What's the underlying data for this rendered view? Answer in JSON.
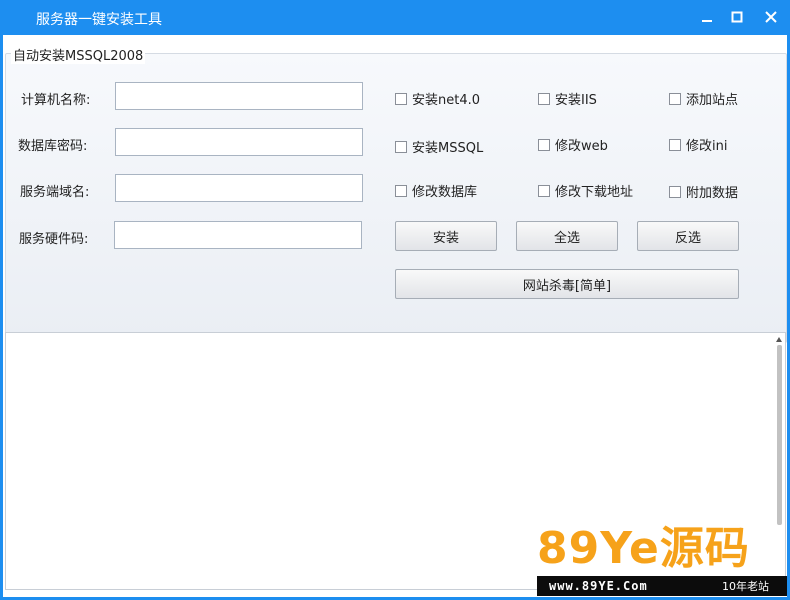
{
  "window": {
    "title": "服务器一键安装工具"
  },
  "group": {
    "legend": "自动安装MSSQL2008"
  },
  "fields": [
    {
      "label": "计算机名称:",
      "value": ""
    },
    {
      "label": "数据库密码:",
      "value": ""
    },
    {
      "label": "服务端域名:",
      "value": ""
    },
    {
      "label": "服务硬件码:",
      "value": ""
    }
  ],
  "checkboxes": [
    {
      "label": "安装net4.0",
      "checked": false
    },
    {
      "label": "安装IIS",
      "checked": false
    },
    {
      "label": "添加站点",
      "checked": false
    },
    {
      "label": "安装MSSQL",
      "checked": false
    },
    {
      "label": "修改web",
      "checked": false
    },
    {
      "label": "修改ini",
      "checked": false
    },
    {
      "label": "修改数据库",
      "checked": false
    },
    {
      "label": "修改下载地址",
      "checked": false
    },
    {
      "label": "附加数据",
      "checked": false
    }
  ],
  "buttons": {
    "install": "安装",
    "select_all": "全选",
    "invert": "反选",
    "antivirus": "网站杀毒[简单]"
  },
  "watermark": {
    "brand": "89Ye源码",
    "url": "www.89YE.Com",
    "tagline": "10年老站",
    "brand_color": "#f6a21a"
  },
  "colors": {
    "titlebar": "#1d8ef0"
  },
  "icons": {
    "minimize": "minimize-icon",
    "maximize": "maximize-icon",
    "close": "close-icon"
  }
}
